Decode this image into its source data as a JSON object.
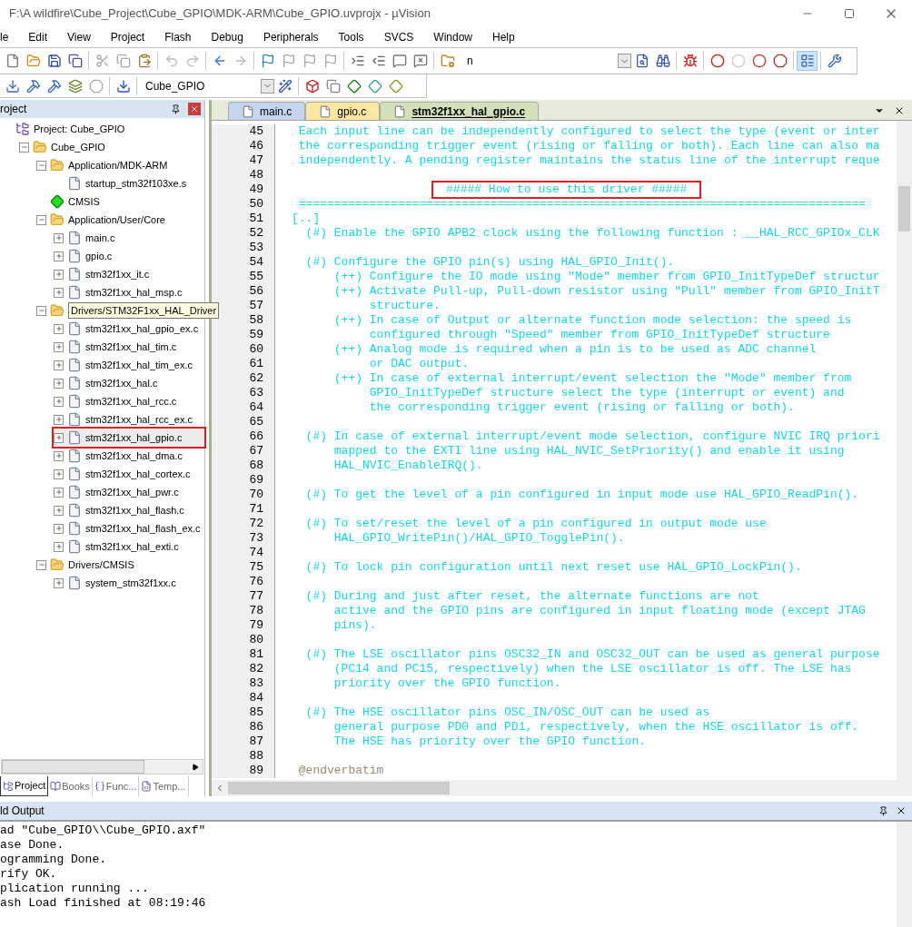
{
  "window": {
    "title": "F:\\A wildfire\\Cube_Project\\Cube_GPIO\\MDK-ARM\\Cube_GPIO.uvprojx - µVision"
  },
  "menu": [
    "le",
    "Edit",
    "View",
    "Project",
    "Flash",
    "Debug",
    "Peripherals",
    "Tools",
    "SVCS",
    "Window",
    "Help"
  ],
  "toolbar": {
    "find_value": "n",
    "target": "Cube_GPIO"
  },
  "project_panel": {
    "title": "roject",
    "tree": [
      {
        "kind": "project",
        "label": "Project: Cube_GPIO",
        "children": [
          {
            "kind": "target",
            "label": "Cube_GPIO",
            "expanded": true,
            "children": [
              {
                "kind": "folder",
                "label": "Application/MDK-ARM",
                "expanded": true,
                "children": [
                  {
                    "kind": "file",
                    "label": "startup_stm32f103xe.s"
                  }
                ]
              },
              {
                "kind": "component",
                "label": "CMSIS"
              },
              {
                "kind": "folder",
                "label": "Application/User/Core",
                "expanded": true,
                "children": [
                  {
                    "kind": "file",
                    "label": "main.c",
                    "expanded": false
                  },
                  {
                    "kind": "file",
                    "label": "gpio.c",
                    "expanded": false
                  },
                  {
                    "kind": "file",
                    "label": "stm32f1xx_it.c",
                    "expanded": false
                  },
                  {
                    "kind": "file",
                    "label": "stm32f1xx_hal_msp.c",
                    "expanded": false
                  }
                ]
              },
              {
                "kind": "folder",
                "label": "Drivers/STM32F1xx_HAL_Driver",
                "tooltip": true,
                "expanded": true,
                "children": [
                  {
                    "kind": "file",
                    "label": "stm32f1xx_hal_gpio_ex.c",
                    "expanded": false
                  },
                  {
                    "kind": "file",
                    "label": "stm32f1xx_hal_tim.c",
                    "expanded": false
                  },
                  {
                    "kind": "file",
                    "label": "stm32f1xx_hal_tim_ex.c",
                    "expanded": false
                  },
                  {
                    "kind": "file",
                    "label": "stm32f1xx_hal.c",
                    "expanded": false
                  },
                  {
                    "kind": "file",
                    "label": "stm32f1xx_hal_rcc.c",
                    "expanded": false
                  },
                  {
                    "kind": "file",
                    "label": "stm32f1xx_hal_rcc_ex.c",
                    "expanded": false
                  },
                  {
                    "kind": "file",
                    "label": "stm32f1xx_hal_gpio.c",
                    "expanded": false,
                    "highlighted": true
                  },
                  {
                    "kind": "file",
                    "label": "stm32f1xx_hal_dma.c",
                    "expanded": false
                  },
                  {
                    "kind": "file",
                    "label": "stm32f1xx_hal_cortex.c",
                    "expanded": false
                  },
                  {
                    "kind": "file",
                    "label": "stm32f1xx_hal_pwr.c",
                    "expanded": false
                  },
                  {
                    "kind": "file",
                    "label": "stm32f1xx_hal_flash.c",
                    "expanded": false
                  },
                  {
                    "kind": "file",
                    "label": "stm32f1xx_hal_flash_ex.c",
                    "expanded": false
                  },
                  {
                    "kind": "file",
                    "label": "stm32f1xx_hal_exti.c",
                    "expanded": false
                  }
                ]
              },
              {
                "kind": "folder",
                "label": "Drivers/CMSIS",
                "expanded": true,
                "children": [
                  {
                    "kind": "file",
                    "label": "system_stm32f1xx.c",
                    "expanded": false
                  }
                ]
              }
            ]
          }
        ]
      }
    ],
    "tabs": [
      {
        "kind": "project",
        "label": "Project",
        "selected": true
      },
      {
        "kind": "books",
        "label": "Books",
        "selected": false
      },
      {
        "kind": "functions",
        "label": "Func...",
        "selected": false
      },
      {
        "kind": "templates",
        "label": "Temp...",
        "selected": false
      }
    ]
  },
  "editor": {
    "tabs": [
      {
        "label": "main.c",
        "selected": false,
        "color": "#c5d5f0"
      },
      {
        "label": "gpio.c",
        "selected": false,
        "color": "#fbe7a0"
      },
      {
        "label": "stm32f1xx_hal_gpio.c",
        "selected": true,
        "color": "#d4e0b8"
      }
    ],
    "lines": [
      {
        "number": "45",
        "kind": "comment",
        "text": " Each input line can be independently configured to select the type (event or inter"
      },
      {
        "number": "46",
        "kind": "comment",
        "text": " the corresponding trigger event (rising or falling or both). Each line can also ma"
      },
      {
        "number": "47",
        "kind": "comment",
        "text": " independently. A pending register maintains the status line of the interrupt reque"
      },
      {
        "number": "48"
      },
      {
        "number": "49",
        "kind": "comment",
        "text": "                    ##### How to use this driver #####",
        "highlighted": true
      },
      {
        "number": "50",
        "kind": "comment",
        "text": " ================================================================================"
      },
      {
        "number": "51",
        "kind": "comment",
        "text": "[..]"
      },
      {
        "number": "52",
        "kind": "comment",
        "text": "  (#) Enable the GPIO APB2 clock using the following function : __HAL_RCC_GPIOx_CLK"
      },
      {
        "number": "53"
      },
      {
        "number": "54",
        "kind": "comment",
        "text": "  (#) Configure the GPIO pin(s) using HAL_GPIO_Init()."
      },
      {
        "number": "55",
        "kind": "comment",
        "text": "      (++) Configure the IO mode using \"Mode\" member from GPIO_InitTypeDef structur"
      },
      {
        "number": "56",
        "kind": "comment",
        "text": "      (++) Activate Pull-up, Pull-down resistor using \"Pull\" member from GPIO_InitT"
      },
      {
        "number": "57",
        "kind": "comment",
        "text": "           structure."
      },
      {
        "number": "58",
        "kind": "comment",
        "text": "      (++) In case of Output or alternate function mode selection: the speed is"
      },
      {
        "number": "59",
        "kind": "comment",
        "text": "           configured through \"Speed\" member from GPIO_InitTypeDef structure"
      },
      {
        "number": "60",
        "kind": "comment",
        "text": "      (++) Analog mode is required when a pin is to be used as ADC channel"
      },
      {
        "number": "61",
        "kind": "comment",
        "text": "           or DAC output."
      },
      {
        "number": "62",
        "kind": "comment",
        "text": "      (++) In case of external interrupt/event selection the \"Mode\" member from"
      },
      {
        "number": "63",
        "kind": "comment",
        "text": "           GPIO_InitTypeDef structure select the type (interrupt or event) and"
      },
      {
        "number": "64",
        "kind": "comment",
        "text": "           the corresponding trigger event (rising or falling or both)."
      },
      {
        "number": "65"
      },
      {
        "number": "66",
        "kind": "comment",
        "text": "  (#) In case of external interrupt/event mode selection, configure NVIC IRQ priori"
      },
      {
        "number": "67",
        "kind": "comment",
        "text": "      mapped to the EXTI line using HAL_NVIC_SetPriority() and enable it using"
      },
      {
        "number": "68",
        "kind": "comment",
        "text": "      HAL_NVIC_EnableIRQ()."
      },
      {
        "number": "69"
      },
      {
        "number": "70",
        "kind": "comment",
        "text": "  (#) To get the level of a pin configured in input mode use HAL_GPIO_ReadPin()."
      },
      {
        "number": "71"
      },
      {
        "number": "72",
        "kind": "comment",
        "text": "  (#) To set/reset the level of a pin configured in output mode use"
      },
      {
        "number": "73",
        "kind": "comment",
        "text": "      HAL_GPIO_WritePin()/HAL_GPIO_TogglePin()."
      },
      {
        "number": "74"
      },
      {
        "number": "75",
        "kind": "comment",
        "text": "  (#) To lock pin configuration until next reset use HAL_GPIO_LockPin()."
      },
      {
        "number": "76"
      },
      {
        "number": "77",
        "kind": "comment",
        "text": "  (#) During and just after reset, the alternate functions are not"
      },
      {
        "number": "78",
        "kind": "comment",
        "text": "      active and the GPIO pins are configured in input floating mode (except JTAG"
      },
      {
        "number": "79",
        "kind": "comment",
        "text": "      pins)."
      },
      {
        "number": "80"
      },
      {
        "number": "81",
        "kind": "comment",
        "text": "  (#) The LSE oscillator pins OSC32_IN and OSC32_OUT can be used as general purpose"
      },
      {
        "number": "82",
        "kind": "comment",
        "text": "      (PC14 and PC15, respectively) when the LSE oscillator is off. The LSE has"
      },
      {
        "number": "83",
        "kind": "comment",
        "text": "      priority over the GPIO function."
      },
      {
        "number": "84"
      },
      {
        "number": "85",
        "kind": "comment",
        "text": "  (#) The HSE oscillator pins OSC_IN/OSC_OUT can be used as"
      },
      {
        "number": "86",
        "kind": "comment",
        "text": "      general purpose PD0 and PD1, respectively, when the HSE oscillator is off."
      },
      {
        "number": "87",
        "kind": "comment",
        "text": "      The HSE has priority over the GPIO function."
      },
      {
        "number": "88"
      },
      {
        "number": "89",
        "kind": "tag",
        "text": " @endverbatim"
      }
    ]
  },
  "build_output": {
    "title": "ld Output",
    "lines": [
      "ad \"Cube_GPIO\\\\Cube_GPIO.axf\"",
      "ase Done.",
      "ogramming Done.",
      "rify OK.",
      "plication running ...",
      "ash Load finished at 08:19:46"
    ]
  }
}
